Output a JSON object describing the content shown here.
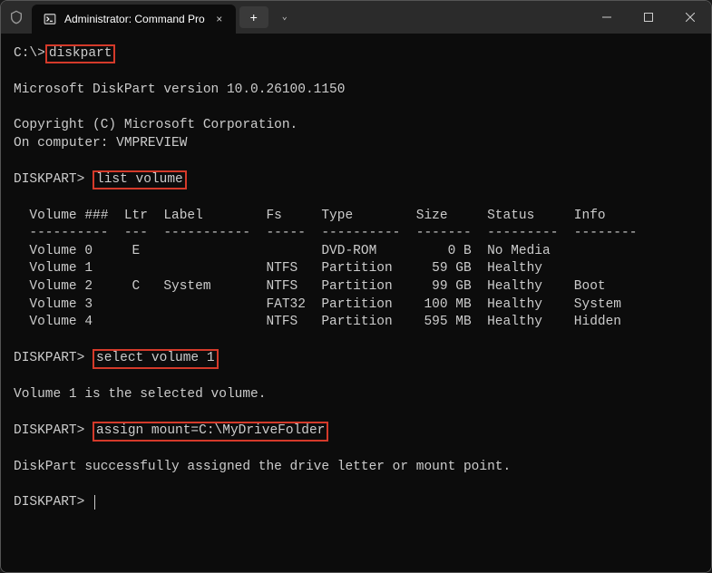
{
  "window": {
    "tab_title": "Administrator: Command Pro",
    "shield_icon": "shield-icon",
    "terminal_icon": "terminal-icon",
    "close_icon": "×",
    "new_tab": "+",
    "dropdown_icon": "⌄",
    "min_icon": "—",
    "max_icon": "▢",
    "win_close_icon": "✕"
  },
  "terminal": {
    "line1_prompt": "C:\\>",
    "cmd1": "diskpart",
    "blank": "",
    "version": "Microsoft DiskPart version 10.0.26100.1150",
    "copyright": "Copyright (C) Microsoft Corporation.",
    "computer": "On computer: VMPREVIEW",
    "dp_prompt": "DISKPART> ",
    "cmd2": "list volume",
    "table_header": "  Volume ###  Ltr  Label        Fs     Type        Size     Status     Info",
    "table_divider": "  ----------  ---  -----------  -----  ----------  -------  ---------  --------",
    "row0": "  Volume 0     E                       DVD-ROM         0 B  No Media",
    "row1": "  Volume 1                      NTFS   Partition     59 GB  Healthy",
    "row2": "  Volume 2     C   System       NTFS   Partition     99 GB  Healthy    Boot",
    "row3": "  Volume 3                      FAT32  Partition    100 MB  Healthy    System",
    "row4": "  Volume 4                      NTFS   Partition    595 MB  Healthy    Hidden",
    "cmd3": "select volume 1",
    "selected_msg": "Volume 1 is the selected volume.",
    "cmd4": "assign mount=C:\\MyDriveFolder",
    "assign_msg": "DiskPart successfully assigned the drive letter or mount point.",
    "final_prompt": "DISKPART> "
  },
  "chart_data": {
    "type": "table",
    "title": "DISKPART list volume",
    "columns": [
      "Volume ###",
      "Ltr",
      "Label",
      "Fs",
      "Type",
      "Size",
      "Status",
      "Info"
    ],
    "rows": [
      [
        "Volume 0",
        "E",
        "",
        "",
        "DVD-ROM",
        "0 B",
        "No Media",
        ""
      ],
      [
        "Volume 1",
        "",
        "",
        "NTFS",
        "Partition",
        "59 GB",
        "Healthy",
        ""
      ],
      [
        "Volume 2",
        "C",
        "System",
        "NTFS",
        "Partition",
        "99 GB",
        "Healthy",
        "Boot"
      ],
      [
        "Volume 3",
        "",
        "",
        "FAT32",
        "Partition",
        "100 MB",
        "Healthy",
        "System"
      ],
      [
        "Volume 4",
        "",
        "",
        "NTFS",
        "Partition",
        "595 MB",
        "Healthy",
        "Hidden"
      ]
    ]
  }
}
